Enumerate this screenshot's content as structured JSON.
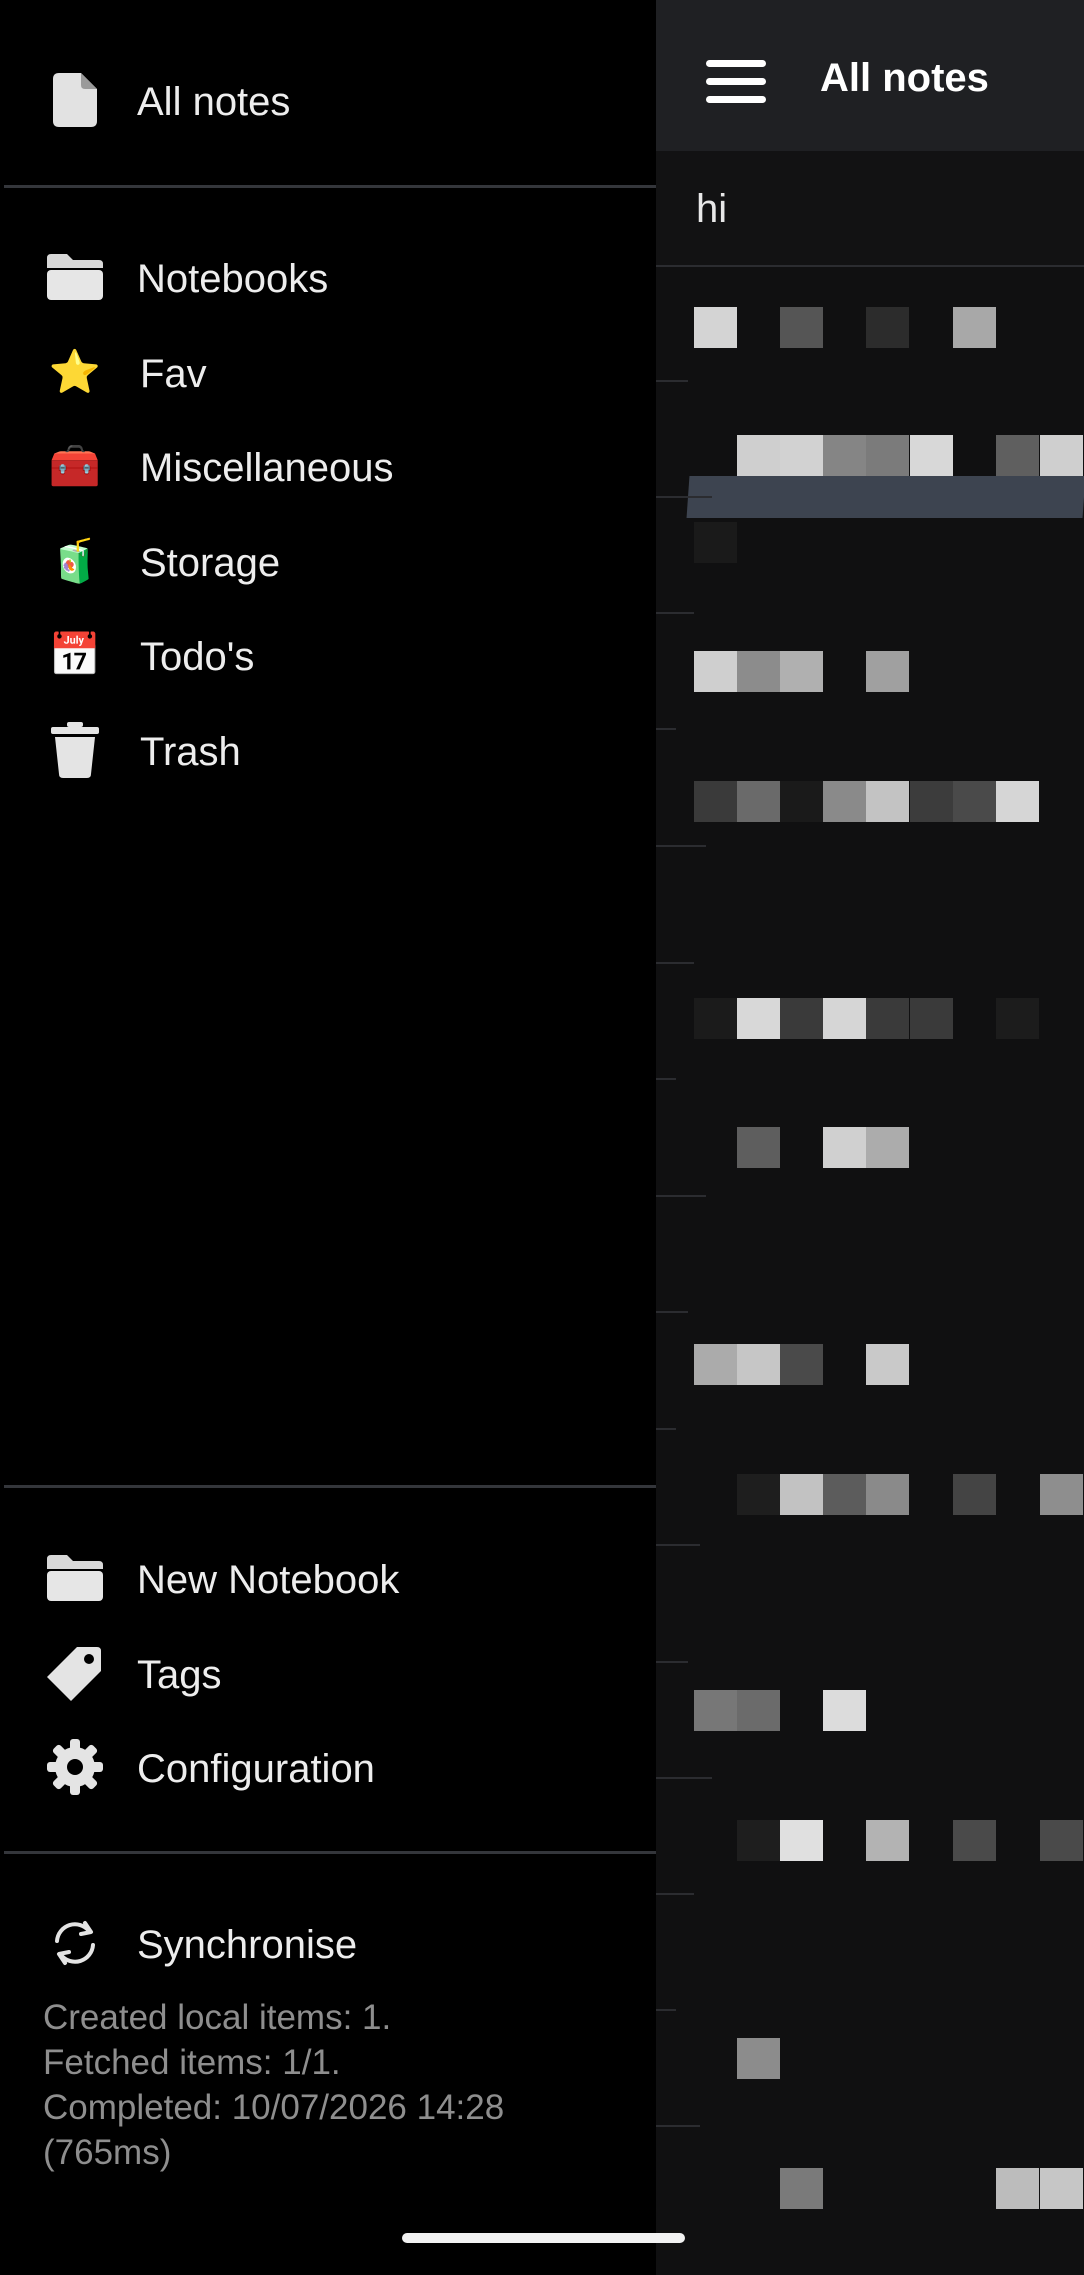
{
  "header": {
    "title": "All notes",
    "menu_icon": "hamburger-icon"
  },
  "search": {
    "value": "hi"
  },
  "drawer": {
    "top_item": {
      "label": "All notes",
      "icon": "document-icon"
    },
    "folders": [
      {
        "label": "Notebooks",
        "icon": "folder-icon"
      },
      {
        "label": "Fav",
        "icon": "star-emoji",
        "emoji": "⭐"
      },
      {
        "label": "Miscellaneous",
        "icon": "toolbox-emoji",
        "emoji": "🧰"
      },
      {
        "label": "Storage",
        "icon": "juice-box-emoji",
        "emoji": "🧃"
      },
      {
        "label": "Todo's",
        "icon": "calendar-emoji",
        "emoji": "📅"
      },
      {
        "label": "Trash",
        "icon": "trash-icon"
      }
    ],
    "actions": [
      {
        "label": "New Notebook",
        "icon": "folder-icon"
      },
      {
        "label": "Tags",
        "icon": "tag-icon"
      },
      {
        "label": "Configuration",
        "icon": "gear-icon"
      }
    ],
    "sync": {
      "label": "Synchronise",
      "icon": "sync-icon",
      "status_lines": [
        "Created local items: 1.",
        "Fetched items: 1/1.",
        "Completed: 10/07/2026 14:28",
        "(765ms)"
      ]
    }
  },
  "colors": {
    "drawer_bg": "#000000",
    "list_bg": "#101011",
    "header_bg": "#1f2023",
    "selected_row": "#3d4450",
    "divider": "#34363b",
    "text_primary": "#ededed",
    "text_secondary": "#8e8e8e"
  }
}
